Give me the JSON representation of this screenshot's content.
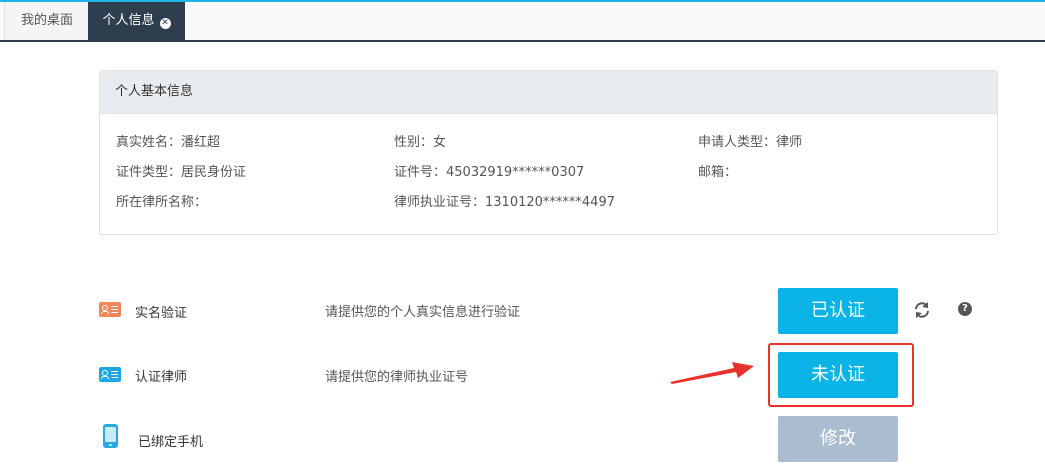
{
  "tabs": [
    {
      "label": "我的桌面"
    },
    {
      "label": "个人信息",
      "close_icon": "close-circle-icon"
    }
  ],
  "panel": {
    "title": "个人基本信息",
    "fields": [
      {
        "label": "真实姓名",
        "value": "潘红超"
      },
      {
        "label": "性别",
        "value": "女"
      },
      {
        "label": "申请人类型",
        "value": "律师"
      },
      {
        "label": "证件类型",
        "value": "居民身份证"
      },
      {
        "label": "证件号",
        "value": "45032919******0307"
      },
      {
        "label": "邮箱",
        "value": ""
      },
      {
        "label": "所在律所名称",
        "value": ""
      },
      {
        "label": "律师执业证号",
        "value": "1310120******4497"
      }
    ],
    "field_texts": [
      "真实姓名：潘红超",
      "性别：女",
      "申请人类型：律师",
      "证件类型：居民身份证",
      "证件号：45032919******0307",
      "邮箱：",
      "所在律所名称：",
      "律师执业证号：1310120******4497"
    ]
  },
  "rows": [
    {
      "icon": "id-card-icon",
      "label": "实名验证",
      "desc": "请提供您的个人真实信息进行验证",
      "button": "已认证",
      "color": "#f0875a"
    },
    {
      "icon": "id-card-icon",
      "label": "认证律师",
      "desc": "请提供您的律师执业证号",
      "button": "未认证",
      "color": "#1ea6e6"
    },
    {
      "icon": "phone-icon",
      "label": "已绑定手机",
      "desc": "",
      "button": "修改"
    }
  ],
  "icons": {
    "refresh": "refresh-icon",
    "help": "question-circle-icon"
  },
  "colors": {
    "primary": "#0ab4e6",
    "disabled": "#aabccf",
    "highlight": "#e8322c",
    "tab_dark": "#2f3e4e"
  }
}
